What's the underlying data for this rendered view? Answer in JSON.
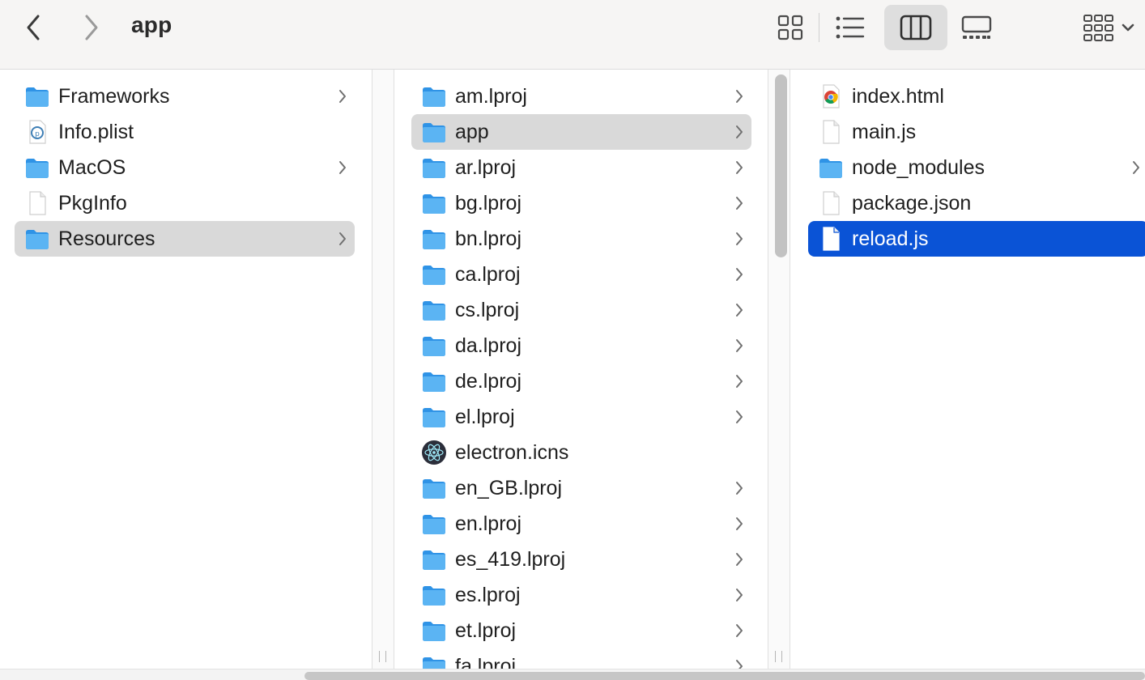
{
  "window": {
    "title": "app"
  },
  "toolbar": {
    "back_icon": "chevron-left-icon",
    "forward_icon": "chevron-right-icon",
    "views": [
      {
        "name": "icon-view",
        "icon": "grid-icon",
        "active": false
      },
      {
        "name": "list-view",
        "icon": "list-icon",
        "active": false
      },
      {
        "name": "column-view",
        "icon": "columns-icon",
        "active": true
      },
      {
        "name": "gallery-view",
        "icon": "gallery-icon",
        "active": false
      }
    ],
    "group_icon": "group-grid-icon"
  },
  "columns": [
    {
      "items": [
        {
          "label": "Frameworks",
          "icon": "folder-icon",
          "has_children": true,
          "selected": false
        },
        {
          "label": "Info.plist",
          "icon": "plist-file-icon",
          "has_children": false,
          "selected": false
        },
        {
          "label": "MacOS",
          "icon": "folder-icon",
          "has_children": true,
          "selected": false
        },
        {
          "label": "PkgInfo",
          "icon": "document-icon",
          "has_children": false,
          "selected": false
        },
        {
          "label": "Resources",
          "icon": "folder-icon",
          "has_children": true,
          "selected": "path"
        }
      ]
    },
    {
      "items": [
        {
          "label": "am.lproj",
          "icon": "folder-icon",
          "has_children": true,
          "selected": false
        },
        {
          "label": "app",
          "icon": "folder-icon",
          "has_children": true,
          "selected": "path"
        },
        {
          "label": "ar.lproj",
          "icon": "folder-icon",
          "has_children": true,
          "selected": false
        },
        {
          "label": "bg.lproj",
          "icon": "folder-icon",
          "has_children": true,
          "selected": false
        },
        {
          "label": "bn.lproj",
          "icon": "folder-icon",
          "has_children": true,
          "selected": false
        },
        {
          "label": "ca.lproj",
          "icon": "folder-icon",
          "has_children": true,
          "selected": false
        },
        {
          "label": "cs.lproj",
          "icon": "folder-icon",
          "has_children": true,
          "selected": false
        },
        {
          "label": "da.lproj",
          "icon": "folder-icon",
          "has_children": true,
          "selected": false
        },
        {
          "label": "de.lproj",
          "icon": "folder-icon",
          "has_children": true,
          "selected": false
        },
        {
          "label": "el.lproj",
          "icon": "folder-icon",
          "has_children": true,
          "selected": false
        },
        {
          "label": "electron.icns",
          "icon": "electron-icon",
          "has_children": false,
          "selected": false
        },
        {
          "label": "en_GB.lproj",
          "icon": "folder-icon",
          "has_children": true,
          "selected": false
        },
        {
          "label": "en.lproj",
          "icon": "folder-icon",
          "has_children": true,
          "selected": false
        },
        {
          "label": "es_419.lproj",
          "icon": "folder-icon",
          "has_children": true,
          "selected": false
        },
        {
          "label": "es.lproj",
          "icon": "folder-icon",
          "has_children": true,
          "selected": false
        },
        {
          "label": "et.lproj",
          "icon": "folder-icon",
          "has_children": true,
          "selected": false
        },
        {
          "label": "fa.lproj",
          "icon": "folder-icon",
          "has_children": true,
          "selected": false
        }
      ]
    },
    {
      "items": [
        {
          "label": "index.html",
          "icon": "chrome-html-icon",
          "has_children": false,
          "selected": false
        },
        {
          "label": "main.js",
          "icon": "document-icon",
          "has_children": false,
          "selected": false
        },
        {
          "label": "node_modules",
          "icon": "folder-icon",
          "has_children": true,
          "selected": false
        },
        {
          "label": "package.json",
          "icon": "document-icon",
          "has_children": false,
          "selected": false
        },
        {
          "label": "reload.js",
          "icon": "document-icon",
          "has_children": false,
          "selected": "active"
        }
      ]
    }
  ],
  "colors": {
    "selection_active": "#0a53d6",
    "selection_path": "#d9d9d9",
    "folder": "#5bb4f3",
    "toolbar_bg": "#f6f5f4"
  }
}
